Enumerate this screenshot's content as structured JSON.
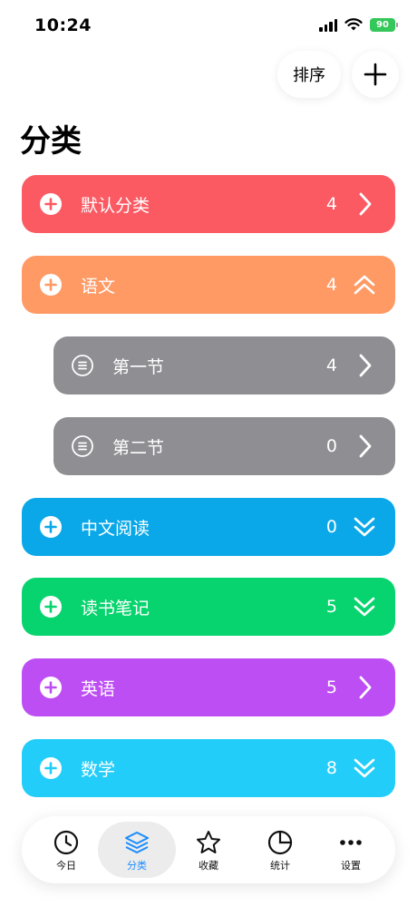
{
  "status": {
    "time": "10:24",
    "battery": "90"
  },
  "toolbar": {
    "sort_label": "排序"
  },
  "title": "分类",
  "categories": [
    {
      "label": "默认分类",
      "count": "4",
      "color": "#fb5a63",
      "icon": "plus-circle-icon",
      "trail": "chevron-right-icon"
    },
    {
      "label": "语文",
      "count": "4",
      "color": "#ff9a65",
      "icon": "plus-circle-icon",
      "trail": "double-chevron-up-icon"
    },
    {
      "label": "第一节",
      "count": "4",
      "color": "#8e8e93",
      "icon": "list-circle-icon",
      "trail": "chevron-right-icon"
    },
    {
      "label": "第二节",
      "count": "0",
      "color": "#8e8e93",
      "icon": "list-circle-icon",
      "trail": "chevron-right-icon"
    },
    {
      "label": "中文阅读",
      "count": "0",
      "color": "#0aa8e8",
      "icon": "plus-circle-icon",
      "trail": "double-chevron-down-icon"
    },
    {
      "label": "读书笔记",
      "count": "5",
      "color": "#07d46e",
      "icon": "plus-circle-icon",
      "trail": "double-chevron-down-icon"
    },
    {
      "label": "英语",
      "count": "5",
      "color": "#bd4ef4",
      "icon": "plus-circle-icon",
      "trail": "chevron-right-icon"
    },
    {
      "label": "数学",
      "count": "8",
      "color": "#22cdfa",
      "icon": "plus-circle-icon",
      "trail": "double-chevron-down-icon"
    }
  ],
  "tabs": [
    {
      "label": "今日",
      "icon": "clock-icon"
    },
    {
      "label": "分类",
      "icon": "layers-icon",
      "active": true
    },
    {
      "label": "收藏",
      "icon": "star-icon"
    },
    {
      "label": "统计",
      "icon": "pie-chart-icon"
    },
    {
      "label": "设置",
      "icon": "more-icon"
    }
  ],
  "colors": {
    "active_tab": "#1a8cff",
    "battery": "#34c759"
  }
}
